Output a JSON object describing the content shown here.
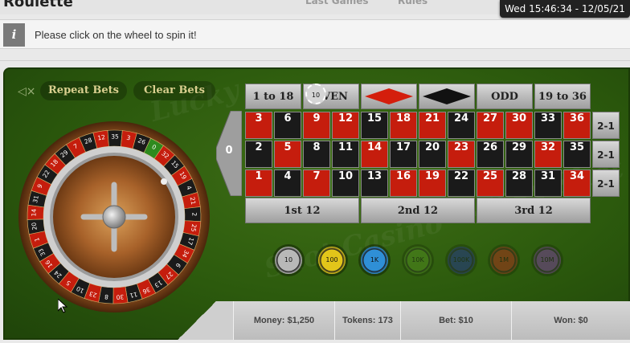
{
  "header": {
    "app_title": "Roulette",
    "link_left": "Last Games",
    "link_right": "Rules",
    "clock": "Wed 15:46:34 - 12/05/21"
  },
  "message": {
    "icon": "info-icon",
    "icon_glyph": "i",
    "text": "Please click on the wheel to spin it!"
  },
  "controls": {
    "repeat_bets": "Repeat Bets",
    "clear_bets": "Clear Bets",
    "mute_icon": "speaker-muted-icon"
  },
  "wheel": {
    "numbers": [
      0,
      32,
      15,
      19,
      4,
      21,
      2,
      25,
      17,
      34,
      6,
      27,
      13,
      36,
      11,
      30,
      8,
      23,
      10,
      5,
      24,
      16,
      33,
      1,
      20,
      14,
      31,
      9,
      22,
      18,
      29,
      7,
      28,
      12,
      35,
      3,
      26
    ],
    "red": [
      1,
      3,
      5,
      7,
      9,
      12,
      14,
      16,
      18,
      19,
      21,
      23,
      25,
      27,
      30,
      32,
      34,
      36
    ],
    "colors": {
      "red": "#c51d0d",
      "black": "#1a1a1a",
      "green": "#2e8a1e"
    }
  },
  "board": {
    "zero": "0",
    "rows": [
      [
        3,
        6,
        9,
        12,
        15,
        18,
        21,
        24,
        27,
        30,
        33,
        36
      ],
      [
        2,
        5,
        8,
        11,
        14,
        17,
        20,
        23,
        26,
        29,
        32,
        35
      ],
      [
        1,
        4,
        7,
        10,
        13,
        16,
        19,
        22,
        25,
        28,
        31,
        34
      ]
    ],
    "column_bets": [
      "2-1",
      "2-1",
      "2-1"
    ],
    "top_bets": [
      "1 to 18",
      "EVEN",
      "",
      "",
      "ODD",
      "19 to 36"
    ],
    "dozens": [
      "1st 12",
      "2nd 12",
      "3rd 12"
    ],
    "placed_chip": "10"
  },
  "chips": [
    {
      "label": "10",
      "color": "#b8b8b8"
    },
    {
      "label": "100",
      "color": "#e2c51a"
    },
    {
      "label": "1K",
      "color": "#2f8fd6"
    },
    {
      "label": "10K",
      "color": "#4f8a1f"
    },
    {
      "label": "100K",
      "color": "#23338a"
    },
    {
      "label": "1M",
      "color": "#a8321e"
    },
    {
      "label": "10M",
      "color": "#7a3e9a"
    }
  ],
  "status": {
    "money": "Money: $1,250",
    "tokens": "Tokens: 173",
    "bet": "Bet: $10",
    "won": "Won: $0"
  }
}
